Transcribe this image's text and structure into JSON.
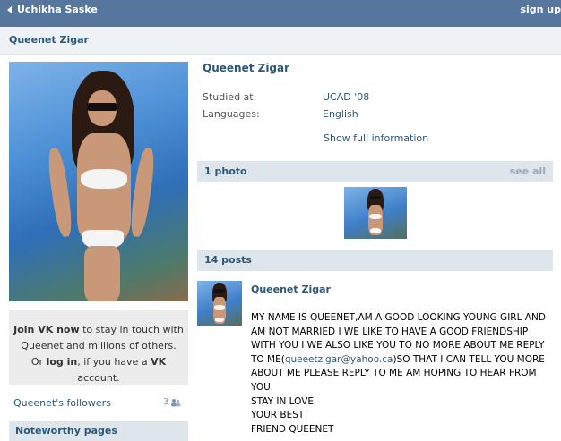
{
  "topbar": {
    "back_label": "Uchikha Saske",
    "signup_label": "sign up"
  },
  "header": {
    "title": "Queenet Zigar"
  },
  "profile": {
    "name": "Queenet Zigar",
    "info": [
      {
        "label": "Studied at:",
        "value": "UCAD '08"
      },
      {
        "label": "Languages:",
        "value": "English"
      }
    ],
    "show_full": "Show full information"
  },
  "join": {
    "line1_bold": "Join VK now",
    "line1_rest": " to stay in touch with",
    "line2": "Queenet and millions of others.",
    "line3_a": "Or ",
    "line3_login": "log in",
    "line3_b": ", if you have a ",
    "line3_vk": "VK",
    "line3_c": " account."
  },
  "followers": {
    "label": "Queenet's followers",
    "count": "3"
  },
  "noteworthy": {
    "label": "Noteworthy pages"
  },
  "photos": {
    "label": "1 photo",
    "see_all": "see all"
  },
  "posts": {
    "label": "14 posts",
    "author": "Queenet Zigar",
    "text_a": "MY NAME IS QUEENET,AM A GOOD LOOKING YOUNG GIRL AND AM NOT MARRIED I WE LIKE TO HAVE A GOOD FRIENDSHIP WITH YOU I WE ALSO LIKE YOU TO NO MORE ABOUT ME REPLY TO ME(",
    "email": "queeetzigar@yahoo.ca",
    "text_b": ")SO THAT I CAN TELL YOU MORE ABOUT ME PLEASE REPLY TO ME AM HOPING TO HEAR FROM YOU.\nSTAY IN LOVE\nYOUR BEST\nFRIEND QUEENET"
  }
}
